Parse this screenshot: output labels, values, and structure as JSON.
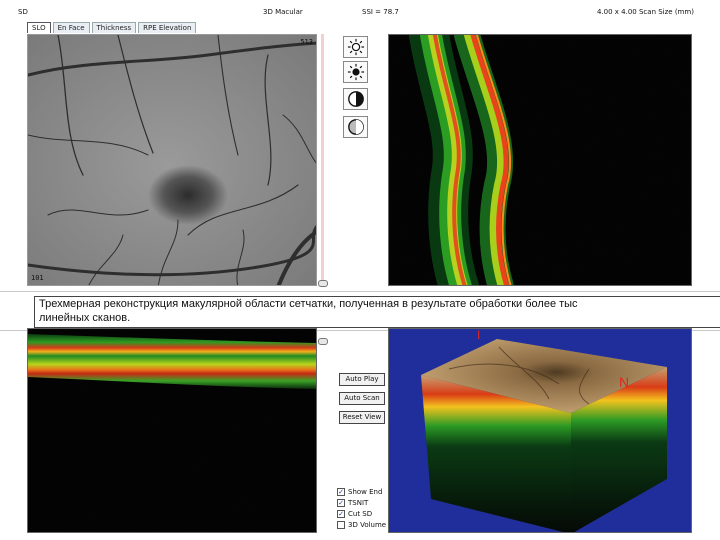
{
  "header": {
    "left_label": "SD",
    "mode": "3D Macular",
    "ssi": "SSI = 78.7",
    "scan_size": "4.00 x 4.00 Scan Size (mm)"
  },
  "tabs": [
    {
      "label": "SLO",
      "active": true
    },
    {
      "label": "En Face",
      "active": false
    },
    {
      "label": "Thickness",
      "active": false
    },
    {
      "label": "RPE Elevation",
      "active": false
    }
  ],
  "slo": {
    "tag_top_right": "513",
    "tag_bottom_left": "101"
  },
  "tools": {
    "icons": [
      "brightness-high-icon",
      "brightness-low-icon",
      "contrast-icon",
      "contrast-alt-icon"
    ],
    "buttons": {
      "auto_play": "Auto Play",
      "auto_scan": "Auto Scan",
      "reset_view": "Reset View"
    },
    "checkboxes": [
      {
        "label": "Show End",
        "checked": true
      },
      {
        "label": "TSNIT",
        "checked": true
      },
      {
        "label": "Cut SD",
        "checked": true
      },
      {
        "label": "3D Volume",
        "checked": false
      }
    ]
  },
  "caption": {
    "line1": "Трехмерная реконструкция макулярной области сетчатки, полученная в результате обработки более тыс",
    "line2": "линейных сканов."
  },
  "render3d": {
    "marker_n": "N",
    "marker_i": "I"
  }
}
